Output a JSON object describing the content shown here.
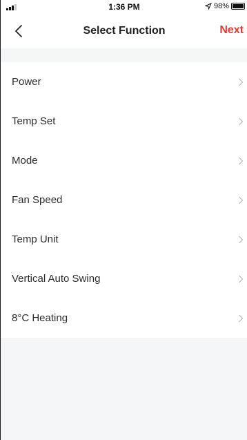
{
  "status_bar": {
    "time": "1:36 PM",
    "battery": "98%",
    "battery_level": 0.98,
    "icons": [
      "signal-icon",
      "location-arrow-icon",
      "battery-icon"
    ]
  },
  "header": {
    "back_icon": "chevron-left-icon",
    "title": "Select Function",
    "next_label": "Next"
  },
  "functions": [
    {
      "label": "Power"
    },
    {
      "label": "Temp Set"
    },
    {
      "label": "Mode"
    },
    {
      "label": "Fan Speed"
    },
    {
      "label": "Temp Unit"
    },
    {
      "label": "Vertical Auto Swing"
    },
    {
      "label": "8°C Heating"
    }
  ],
  "colors": {
    "accent": "#e13a37",
    "background": "#f5f6f8",
    "card": "#ffffff",
    "chevron": "#b8b8b8"
  }
}
